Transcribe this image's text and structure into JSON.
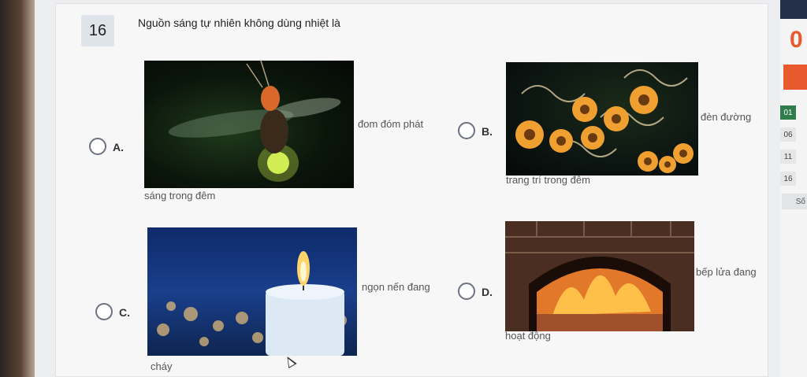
{
  "question": {
    "number": "16",
    "text": "Nguồn sáng tự nhiên không dùng nhiệt là"
  },
  "options": [
    {
      "letter": "A.",
      "caption_line1": "đom đóm phát",
      "caption_line2": "sáng trong đêm"
    },
    {
      "letter": "B.",
      "caption_line1": "đèn đường",
      "caption_line2": "trang trí trong đêm"
    },
    {
      "letter": "C.",
      "caption_line1": "ngọn nến đang",
      "caption_line2": "cháy"
    },
    {
      "letter": "D.",
      "caption_line1": "bếp lửa đang",
      "caption_line2": "hoạt động"
    }
  ],
  "side_panel": {
    "timer": "0",
    "question_cells": [
      "01",
      "06",
      "11",
      "16"
    ],
    "footer": "Số"
  },
  "colors": {
    "accent": "#e8592e",
    "done": "#2e7d4a",
    "radio_border": "#6b7280"
  }
}
